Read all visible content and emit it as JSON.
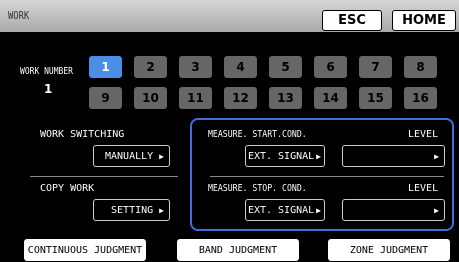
{
  "header": {
    "title": "WORK",
    "esc_label": "ESC",
    "home_label": "HOME"
  },
  "work_number": {
    "label": "WORK NUMBER",
    "current": "1",
    "buttons": [
      "1",
      "2",
      "3",
      "4",
      "5",
      "6",
      "7",
      "8",
      "9",
      "10",
      "11",
      "12",
      "13",
      "14",
      "15",
      "16"
    ],
    "selected": "1"
  },
  "work_switching": {
    "label": "WORK SWITCHING",
    "value": "MANUALLY"
  },
  "copy_work": {
    "label": "COPY WORK",
    "value": "SETTING"
  },
  "measure_start": {
    "label": "MEASURE. START.COND.",
    "value": "EXT. SIGNAL",
    "level_label": "LEVEL",
    "level_value": ""
  },
  "measure_stop": {
    "label": "MEASURE. STOP. COND.",
    "value": "EXT. SIGNAL",
    "level_label": "LEVEL",
    "level_value": ""
  },
  "footer": {
    "continuous": "CONTINUOUS JUDGMENT",
    "band": "BAND JUDGMENT",
    "zone": "ZONE JUDGMENT"
  },
  "colors": {
    "selected": "#4b8ee6",
    "unselected": "#666666",
    "panel_border": "#3f6fd6"
  }
}
